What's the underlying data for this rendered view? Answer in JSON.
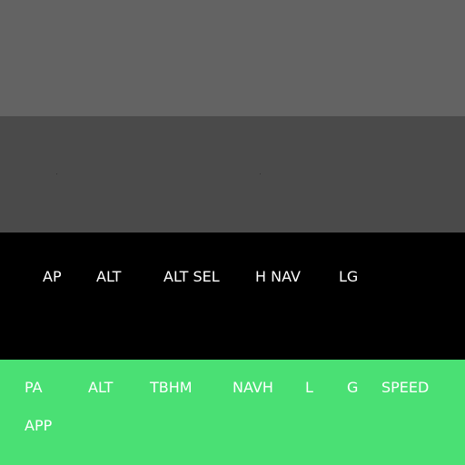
{
  "colors": {
    "top_band": "#636363",
    "middle_band": "#4a4a4a",
    "black_band": "#000000",
    "green_band": "#4ae074",
    "label_text": "#ffffff"
  },
  "mode_bar": {
    "items": [
      "AP",
      "ALT",
      "ALT SEL",
      "H NAV",
      "LG"
    ]
  },
  "green_panel": {
    "row1": [
      "PA",
      "ALT",
      "TBHM",
      "NAVH",
      "L",
      "G",
      "SPEED"
    ],
    "row2": [
      "APP"
    ]
  }
}
